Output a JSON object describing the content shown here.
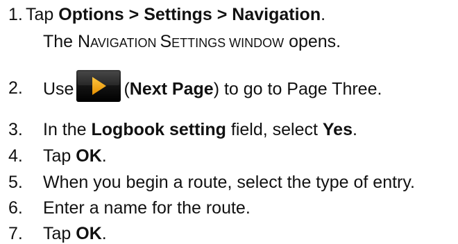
{
  "steps": [
    {
      "number": "1.",
      "pre": "Tap ",
      "bold": "Options > Settings > Navigation",
      "post": "."
    },
    {
      "result_parts": {
        "a": "The ",
        "n1": "N",
        "n2": "AVIGATION ",
        "s1": "S",
        "s2": "ETTINGS WINDOW",
        "c": " opens."
      }
    },
    {
      "number": "2.",
      "pre": "Use",
      "icon": "next-page-arrow-icon",
      "paren_open": "(",
      "bold": "Next Page",
      "post": ") to go to Page Three."
    },
    {
      "number": "3.",
      "pre": "In the ",
      "bold": "Logbook setting",
      "mid": " field, select ",
      "bold2": "Yes",
      "post": "."
    },
    {
      "number": "4.",
      "pre": "Tap ",
      "bold": "OK",
      "post": "."
    },
    {
      "number": "5.",
      "text": "When you begin a route, select the type of entry."
    },
    {
      "number": "6.",
      "text": "Enter a name for the route."
    },
    {
      "number": "7.",
      "pre": "Tap ",
      "bold": "OK",
      "post": "."
    }
  ],
  "colors": {
    "icon_bg": "#1a1a1a",
    "icon_arrow": "#f5a800"
  }
}
